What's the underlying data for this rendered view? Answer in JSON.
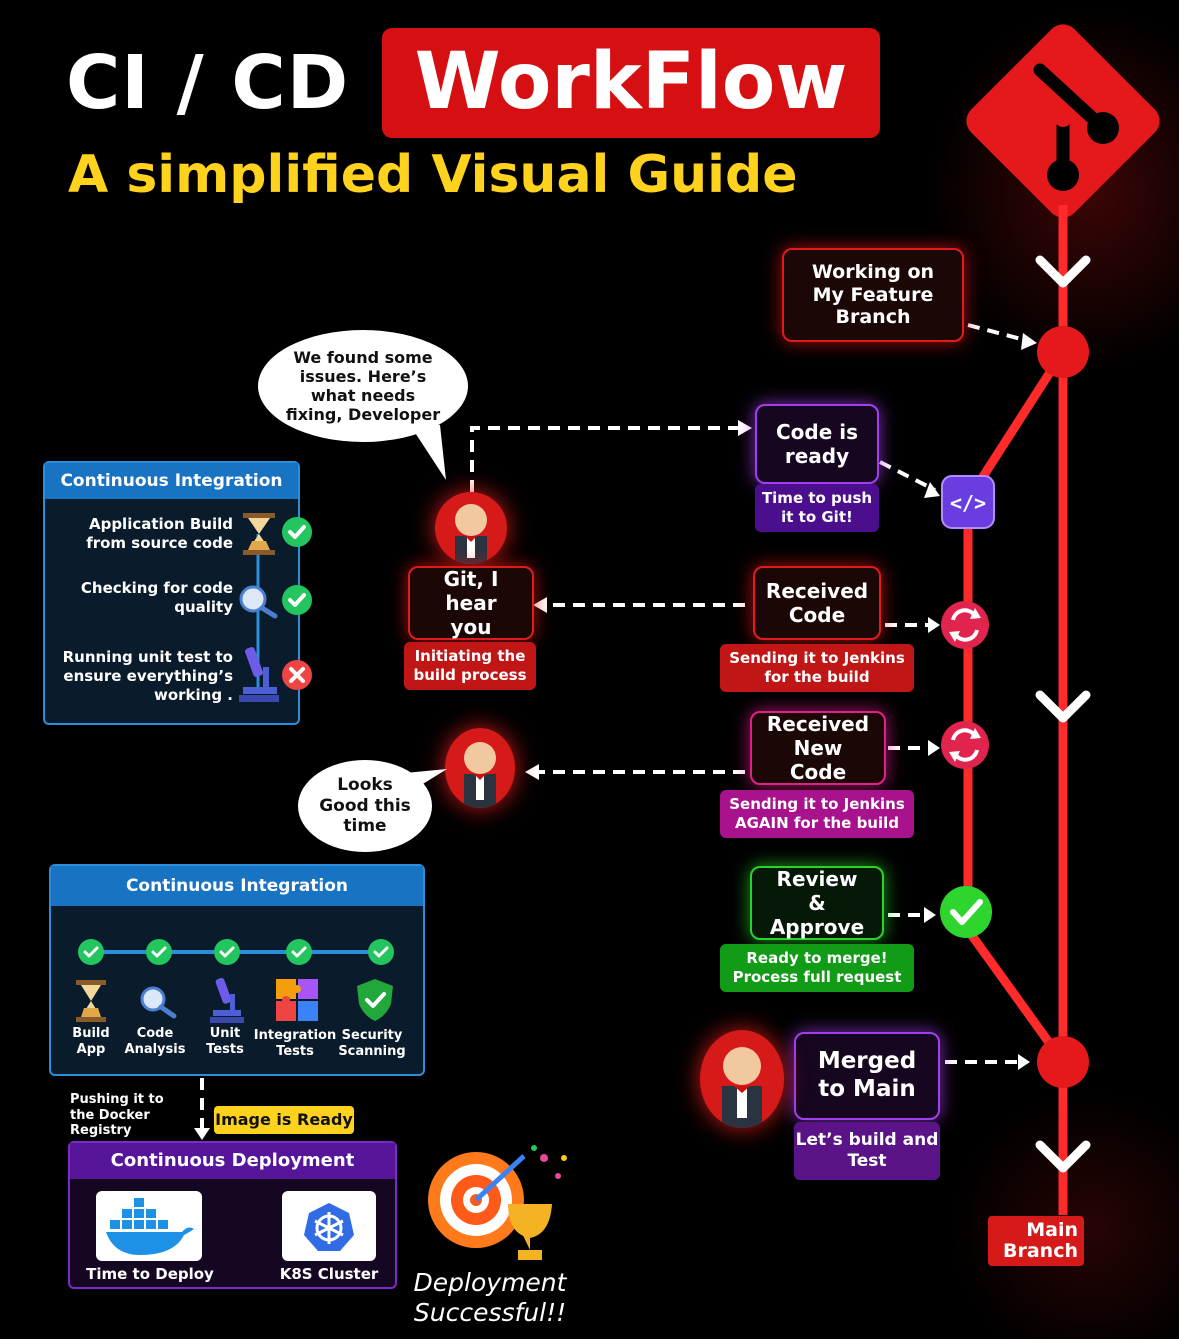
{
  "header": {
    "title_part1": "CI / CD",
    "title_part2": "WorkFlow",
    "subtitle": "A simplified Visual Guide"
  },
  "colors": {
    "accent_red": "#d61a1a",
    "title_yellow": "#ffd21e",
    "ci_blue": "#1874c2",
    "cd_purple": "#57169a",
    "ok_green": "#22c55e",
    "fail_red": "#ef4444"
  },
  "flow": {
    "working_feature": "Working on My Feature Branch",
    "code_ready": "Code is ready",
    "code_ready_sub": "Time to push it to Git!",
    "received_code": "Received Code",
    "received_code_sub": "Sending it to Jenkins for the build",
    "received_new_code": "Received New Code",
    "received_new_code_sub": "Sending it to Jenkins AGAIN for the build",
    "review_approve": "Review & Approve",
    "review_sub": "Ready to merge! Process full request",
    "merged_main": "Merged to Main",
    "merged_sub": "Let’s build and Test",
    "git_hear": "Git, I hear you",
    "git_hear_sub": "Initiating the build process",
    "main_branch": "Main Branch"
  },
  "bubbles": {
    "issues": "We found some issues. Here’s what needs fixing, Developer",
    "looks_good": "Looks Good this time"
  },
  "ci_top": {
    "title": "Continuous Integration",
    "steps": [
      {
        "label": "Application Build from source code",
        "status": "pass",
        "icon": "hourglass-icon"
      },
      {
        "label": "Checking for code quality",
        "status": "pass",
        "icon": "magnifier-icon"
      },
      {
        "label": "Running unit test to ensure everything’s working .",
        "status": "fail",
        "icon": "microscope-icon"
      }
    ]
  },
  "ci_bottom": {
    "title": "Continuous Integration",
    "stages": [
      {
        "label": "Build App",
        "icon": "hourglass-icon"
      },
      {
        "label": "Code Analysis",
        "icon": "magnifier-icon"
      },
      {
        "label": "Unit Tests",
        "icon": "microscope-icon"
      },
      {
        "label": "Integration Tests",
        "icon": "puzzle-icon"
      },
      {
        "label": "Security Scanning",
        "icon": "shield-icon"
      }
    ]
  },
  "deploy": {
    "push_label": "Pushing it to the Docker Registry",
    "image_ready": "Image is Ready",
    "title": "Continuous Deployment",
    "docker_label": "Time to Deploy",
    "k8s_label": "K8S Cluster",
    "success": "Deployment Successful!!"
  }
}
